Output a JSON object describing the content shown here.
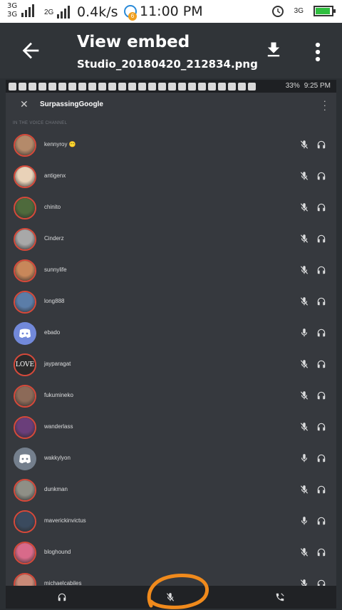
{
  "status_bar": {
    "network_top": "3G",
    "network_bottom": "3G",
    "network_2g": "2G",
    "speed": "0.4k/s",
    "notification_count": "6",
    "time": "11:00 PM",
    "network_right": "3G"
  },
  "viewer": {
    "title": "View embed",
    "filename": "Studio_20180420_212834.png",
    "icons": {
      "back": "arrow-back-icon",
      "download": "download-icon",
      "more": "more-vert-icon"
    }
  },
  "embed": {
    "status_bar": {
      "battery": "33%",
      "time": "9:25 PM"
    },
    "channel_name": "SurpassingGoogle",
    "section_label": "IN THE VOICE CHANNEL",
    "members": [
      {
        "name": "kennyroy 😶",
        "muted": true,
        "avatar_color": "#b48a6a"
      },
      {
        "name": "antigenx",
        "muted": true,
        "avatar_color": "#e9d2b8"
      },
      {
        "name": "chinito",
        "muted": true,
        "avatar_color": "#4e6a3c"
      },
      {
        "name": "Cinderz",
        "muted": true,
        "avatar_color": "#a8a8a8"
      },
      {
        "name": "sunnylife",
        "muted": true,
        "avatar_color": "#c8875a"
      },
      {
        "name": "long888",
        "muted": true,
        "avatar_color": "#5b7da8"
      },
      {
        "name": "ebado",
        "muted": false,
        "avatar_color": "#7289da",
        "discord": true
      },
      {
        "name": "jayparagat",
        "muted": true,
        "avatar_color": "#2a2a2a",
        "text_avatar": "LOVE"
      },
      {
        "name": "fukumineko",
        "muted": true,
        "avatar_color": "#8c6a58"
      },
      {
        "name": "wanderlass",
        "muted": true,
        "avatar_color": "#6a3e7a"
      },
      {
        "name": "wakkylyon",
        "muted": false,
        "avatar_color": "#747f8d",
        "discord": true
      },
      {
        "name": "dunkman",
        "muted": true,
        "avatar_color": "#8f8f86"
      },
      {
        "name": "maverickinvictus",
        "muted": false,
        "avatar_color": "#3a4a5e"
      },
      {
        "name": "bloghound",
        "muted": true,
        "avatar_color": "#d86a8a"
      },
      {
        "name": "michaelcabiles",
        "muted": true,
        "avatar_color": "#c98a78"
      }
    ]
  },
  "colors": {
    "accent_circle": "#f08a1c",
    "mute_icon": "#dcddde",
    "avatar_ring": "#d7493a"
  }
}
